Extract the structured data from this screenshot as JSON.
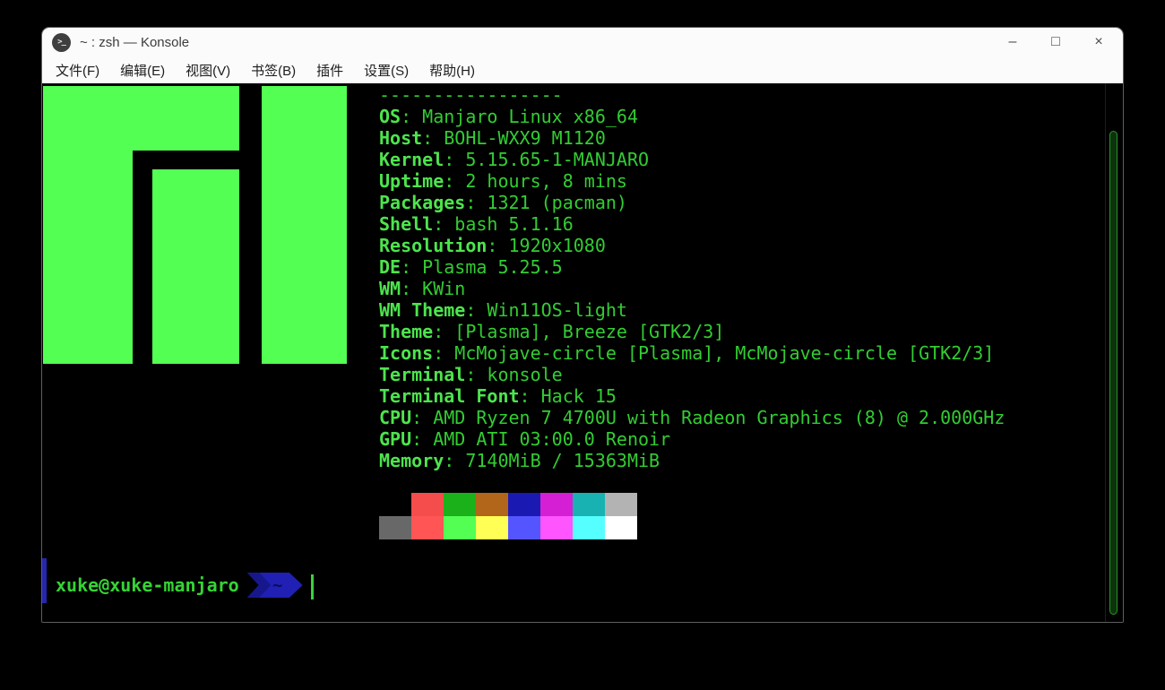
{
  "window": {
    "title": "~ : zsh — Konsole",
    "app_icon_glyph": ">_",
    "controls": {
      "minimize": "–",
      "maximize": "□",
      "close": "×"
    }
  },
  "menu": {
    "items": [
      "文件(F)",
      "编辑(E)",
      "视图(V)",
      "书签(B)",
      "插件",
      "设置(S)",
      "帮助(H)"
    ]
  },
  "terminal": {
    "logo": {
      "name": "manjaro-logo",
      "color": "#54ff54"
    },
    "neofetch": {
      "separator": "-----------------",
      "lines": [
        {
          "label": "OS",
          "value": "Manjaro Linux x86_64"
        },
        {
          "label": "Host",
          "value": "BOHL-WXX9 M1120"
        },
        {
          "label": "Kernel",
          "value": "5.15.65-1-MANJARO"
        },
        {
          "label": "Uptime",
          "value": "2 hours, 8 mins"
        },
        {
          "label": "Packages",
          "value": "1321 (pacman)"
        },
        {
          "label": "Shell",
          "value": "bash 5.1.16"
        },
        {
          "label": "Resolution",
          "value": "1920x1080"
        },
        {
          "label": "DE",
          "value": "Plasma 5.25.5"
        },
        {
          "label": "WM",
          "value": "KWin"
        },
        {
          "label": "WM Theme",
          "value": "Win11OS-light"
        },
        {
          "label": "Theme",
          "value": "[Plasma], Breeze [GTK2/3]"
        },
        {
          "label": "Icons",
          "value": "McMojave-circle [Plasma], McMojave-circle [GTK2/3]"
        },
        {
          "label": "Terminal",
          "value": "konsole"
        },
        {
          "label": "Terminal Font",
          "value": "Hack 15"
        },
        {
          "label": "CPU",
          "value": "AMD Ryzen 7 4700U with Radeon Graphics (8) @ 2.000GHz"
        },
        {
          "label": "GPU",
          "value": "AMD ATI 03:00.0 Renoir"
        },
        {
          "label": "Memory",
          "value": "7140MiB / 15363MiB"
        }
      ],
      "palette": [
        [
          "#000000",
          "#f54c4c",
          "#1bb11b",
          "#b2661a",
          "#1a1ab2",
          "#d41fd4",
          "#18b2b2",
          "#b3b3b3"
        ],
        [
          "#686868",
          "#ff5555",
          "#54ff54",
          "#ffff55",
          "#5555ff",
          "#ff55ff",
          "#55ffff",
          "#ffffff"
        ]
      ]
    },
    "prompt": {
      "user_host": "xuke@xuke-manjaro",
      "path": "~"
    },
    "colors": {
      "background": "#000000",
      "label_green": "#4de44d",
      "value_green": "#32cd32",
      "logo_green": "#54ff54",
      "prompt_green": "#35d435",
      "arrow_blue": "#2020b4",
      "arrow_dark_blue": "#17178c",
      "cursor_green": "#3bd13b",
      "scrollbar_green": "#259625",
      "titlebar_bg": "#fbfbfb"
    }
  }
}
